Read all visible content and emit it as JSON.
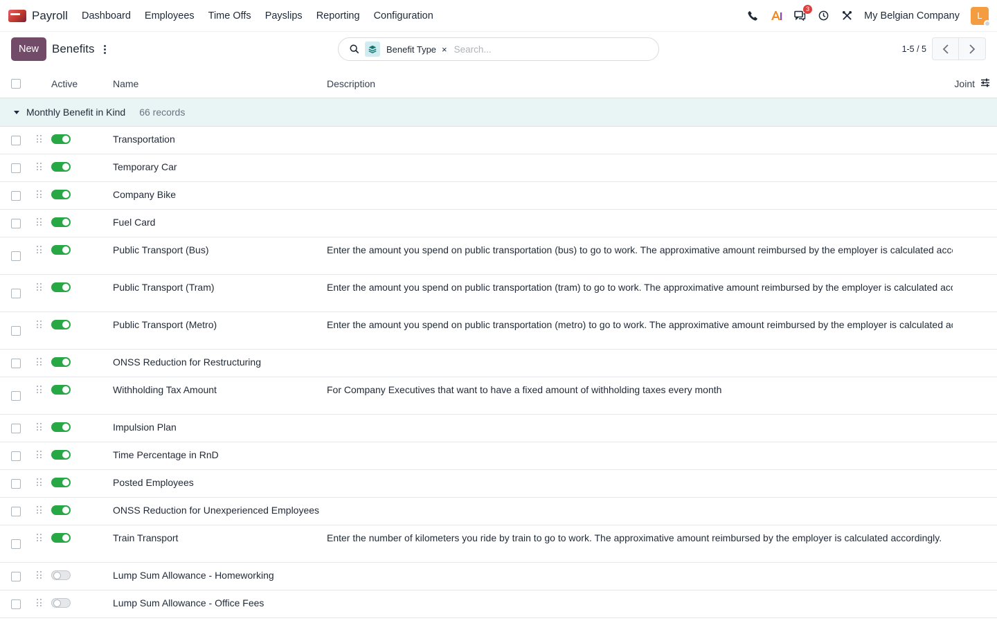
{
  "navbar": {
    "app_name": "Payroll",
    "menu": [
      "Dashboard",
      "Employees",
      "Time Offs",
      "Payslips",
      "Reporting",
      "Configuration"
    ],
    "messages_badge": "3",
    "company": "My Belgian Company",
    "avatar_letter": "L",
    "avatar_color": "#f39c40"
  },
  "control": {
    "new_label": "New",
    "title": "Benefits",
    "search": {
      "facet_label": "Benefit Type",
      "facet_remove": "×",
      "placeholder": "Search..."
    },
    "pager": {
      "value": "1-5 / 5"
    }
  },
  "list": {
    "columns": {
      "active": "Active",
      "name": "Name",
      "description": "Description",
      "joint": "Joint"
    },
    "group": {
      "name": "Monthly Benefit in Kind",
      "count": "66 records"
    },
    "rows": [
      {
        "name": "Transportation",
        "description": "",
        "active": true
      },
      {
        "name": "Temporary Car",
        "description": "",
        "active": true
      },
      {
        "name": "Company Bike",
        "description": "",
        "active": true
      },
      {
        "name": "Fuel Card",
        "description": "",
        "active": true
      },
      {
        "name": "Public Transport (Bus)",
        "description": "Enter the amount you spend on public transportation (bus) to go to work. The approximative amount reimbursed by the employer is calculated accordingly.",
        "active": true
      },
      {
        "name": "Public Transport (Tram)",
        "description": "Enter the amount you spend on public transportation (tram) to go to work. The approximative amount reimbursed by the employer is calculated accordingly.",
        "active": true
      },
      {
        "name": "Public Transport (Metro)",
        "description": "Enter the amount you spend on public transportation (metro) to go to work. The approximative amount reimbursed by the employer is calculated accordingly.",
        "active": true
      },
      {
        "name": "ONSS Reduction for Restructuring",
        "description": "",
        "active": true
      },
      {
        "name": "Withholding Tax Amount",
        "description": "For Company Executives that want to have a fixed amount of withholding taxes every month",
        "active": true
      },
      {
        "name": "Impulsion Plan",
        "description": "",
        "active": true
      },
      {
        "name": "Time Percentage in RnD",
        "description": "",
        "active": true
      },
      {
        "name": "Posted Employees",
        "description": "",
        "active": true
      },
      {
        "name": "ONSS Reduction for Unexperienced Employees",
        "description": "",
        "active": true
      },
      {
        "name": "Train Transport",
        "description": "Enter the number of kilometers you ride by train to go to work. The approximative amount reimbursed by the employer is calculated accordingly.",
        "active": true
      },
      {
        "name": "Lump Sum Allowance - Homeworking",
        "description": "",
        "active": false
      },
      {
        "name": "Lump Sum Allowance - Office Fees",
        "description": "",
        "active": false
      }
    ]
  },
  "colors": {
    "brand": "#714b67",
    "toggle_on": "#28a745",
    "group_bg": "#e9f4f5",
    "badge": "#e03e3e"
  }
}
